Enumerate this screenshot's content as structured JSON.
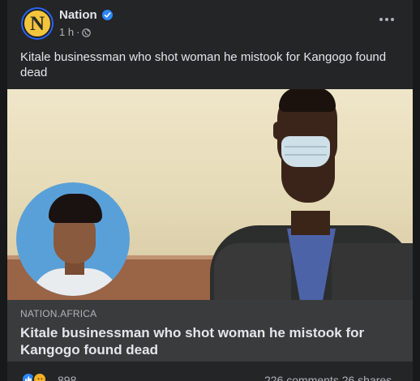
{
  "post": {
    "page_name": "Nation",
    "avatar_letter": "N",
    "time": "1 h",
    "separator": "·",
    "caption": "Kitale businessman who shot woman he mistook for Kangogo found dead"
  },
  "link_preview": {
    "domain": "NATION.AFRICA",
    "title": "Kitale businessman who shot woman he mistook for Kangogo found dead"
  },
  "stats": {
    "reaction_count": "898",
    "comments_shares": "226 comments  26 shares"
  },
  "icons": [
    "verified-badge-icon",
    "globe-icon",
    "more-options-icon",
    "like-reaction-icon",
    "sad-reaction-icon"
  ],
  "colors": {
    "card_bg": "#242526",
    "page_bg": "#18191a",
    "accent_blue": "#2d88ff",
    "secondary_text": "#b0b3b8",
    "link_box_bg": "#3a3b3c"
  }
}
